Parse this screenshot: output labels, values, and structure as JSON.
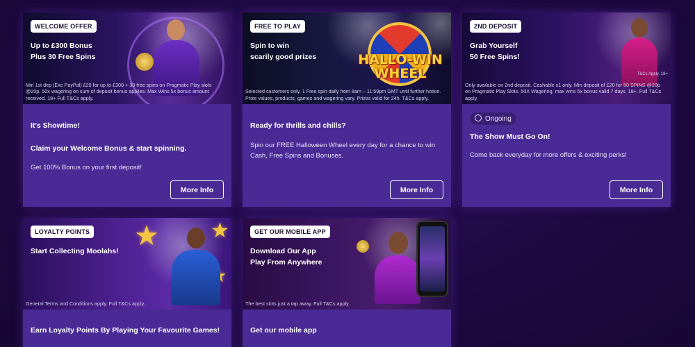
{
  "colors": {
    "page_bg": "#1f0a45",
    "card_bg": "#4a2b96",
    "accent_gold": "#f5c542",
    "badge_bg": "#ffffff"
  },
  "cards": [
    {
      "badge": "WELCOME OFFER",
      "headline_1": "Up to £300 Bonus",
      "headline_2": "Plus 30 Free Spins",
      "terms": "Min 1st dep (Exc PayPal) £20 for up to £300 + 30 free spins on Pragmatic Play slots @20p. 50x wagering on sum of deposit bonus applies. Max Wins 5x bonus amount received. 18+ Full T&Cs apply.",
      "title": "It's Showtime!",
      "subtitle": "Claim your Welcome Bonus & start spinning.",
      "body": "Get 100% Bonus on your first deposit!",
      "button": "More Info"
    },
    {
      "badge": "FREE TO PLAY",
      "headline_1": "Spin to win",
      "headline_2": "scarily good prizes",
      "wheel_title_1": "HALLO-WIN",
      "wheel_title_2": "WHEEL",
      "terms": "Selected customers only. 1 Free spin daily from 8am – 11:59pm GMT until further notice. Prize values, products, games and wagering vary. Prizes valid for 24h. T&Cs apply.",
      "title": "Ready for thrills and chills?",
      "body": "Spin our FREE Halloween Wheel every day for a chance to win Cash, Free Spins and Bonuses.",
      "button": "More Info"
    },
    {
      "badge": "2ND DEPOSIT",
      "headline_1": "Grab Yourself",
      "headline_2": "50 Free Spins!",
      "small_note": "T&Cs Apply. 18+",
      "terms": "Only available on 2nd deposit. Cashable x1 only. Min deposit of £20 for 50 SPINS @20p on Pragmatic Play Slots. 50X Wagering, max wins 5x bonus valid 7 days. 18+. Full T&Cs apply.",
      "status": "Ongoing",
      "title": "The Show Must Go On!",
      "body": "Come back everyday for more offers & exciting perks!",
      "button": "More Info"
    },
    {
      "badge": "LOYALTY POINTS",
      "headline_1": "Start Collecting Moolahs!",
      "terms": "General Terms and Conditions apply. Full T&Cs apply.",
      "title": "Earn Loyalty Points By Playing Your Favourite Games!",
      "body": ""
    },
    {
      "badge": "GET OUR MOBILE APP",
      "headline_1": "Download Our App",
      "headline_2": "Play From Anywhere",
      "terms": "The best slots just a tap away. Full T&Cs apply.",
      "title": "Get our mobile app",
      "body": ""
    }
  ]
}
